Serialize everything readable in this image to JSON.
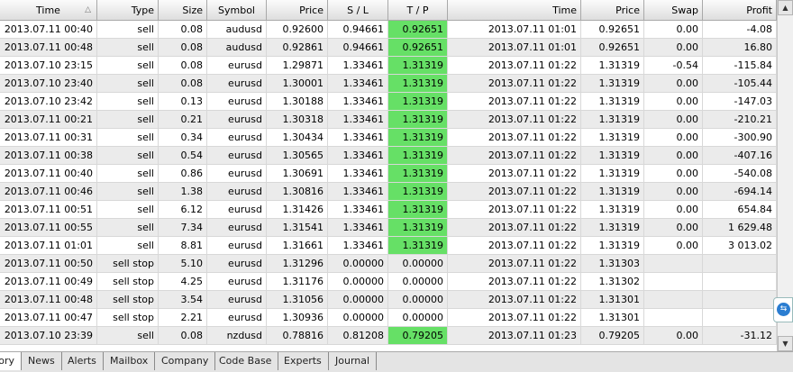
{
  "columns": [
    "Time",
    "Type",
    "Size",
    "Symbol",
    "Price",
    "S / L",
    "T / P",
    "Time",
    "Price",
    "Swap",
    "Profit"
  ],
  "rows": [
    {
      "time": "2013.07.11 00:40",
      "type": "sell",
      "size": "0.08",
      "symbol": "audusd",
      "price": "0.92600",
      "sl": "0.94661",
      "tp": "0.92651",
      "close_time": "2013.07.11 01:01",
      "close_price": "0.92651",
      "swap": "0.00",
      "profit": "-4.08",
      "tp_hit": true
    },
    {
      "time": "2013.07.11 00:48",
      "type": "sell",
      "size": "0.08",
      "symbol": "audusd",
      "price": "0.92861",
      "sl": "0.94661",
      "tp": "0.92651",
      "close_time": "2013.07.11 01:01",
      "close_price": "0.92651",
      "swap": "0.00",
      "profit": "16.80",
      "tp_hit": true
    },
    {
      "time": "2013.07.10 23:15",
      "type": "sell",
      "size": "0.08",
      "symbol": "eurusd",
      "price": "1.29871",
      "sl": "1.33461",
      "tp": "1.31319",
      "close_time": "2013.07.11 01:22",
      "close_price": "1.31319",
      "swap": "-0.54",
      "profit": "-115.84",
      "tp_hit": true
    },
    {
      "time": "2013.07.10 23:40",
      "type": "sell",
      "size": "0.08",
      "symbol": "eurusd",
      "price": "1.30001",
      "sl": "1.33461",
      "tp": "1.31319",
      "close_time": "2013.07.11 01:22",
      "close_price": "1.31319",
      "swap": "0.00",
      "profit": "-105.44",
      "tp_hit": true
    },
    {
      "time": "2013.07.10 23:42",
      "type": "sell",
      "size": "0.13",
      "symbol": "eurusd",
      "price": "1.30188",
      "sl": "1.33461",
      "tp": "1.31319",
      "close_time": "2013.07.11 01:22",
      "close_price": "1.31319",
      "swap": "0.00",
      "profit": "-147.03",
      "tp_hit": true
    },
    {
      "time": "2013.07.11 00:21",
      "type": "sell",
      "size": "0.21",
      "symbol": "eurusd",
      "price": "1.30318",
      "sl": "1.33461",
      "tp": "1.31319",
      "close_time": "2013.07.11 01:22",
      "close_price": "1.31319",
      "swap": "0.00",
      "profit": "-210.21",
      "tp_hit": true
    },
    {
      "time": "2013.07.11 00:31",
      "type": "sell",
      "size": "0.34",
      "symbol": "eurusd",
      "price": "1.30434",
      "sl": "1.33461",
      "tp": "1.31319",
      "close_time": "2013.07.11 01:22",
      "close_price": "1.31319",
      "swap": "0.00",
      "profit": "-300.90",
      "tp_hit": true
    },
    {
      "time": "2013.07.11 00:38",
      "type": "sell",
      "size": "0.54",
      "symbol": "eurusd",
      "price": "1.30565",
      "sl": "1.33461",
      "tp": "1.31319",
      "close_time": "2013.07.11 01:22",
      "close_price": "1.31319",
      "swap": "0.00",
      "profit": "-407.16",
      "tp_hit": true
    },
    {
      "time": "2013.07.11 00:40",
      "type": "sell",
      "size": "0.86",
      "symbol": "eurusd",
      "price": "1.30691",
      "sl": "1.33461",
      "tp": "1.31319",
      "close_time": "2013.07.11 01:22",
      "close_price": "1.31319",
      "swap": "0.00",
      "profit": "-540.08",
      "tp_hit": true
    },
    {
      "time": "2013.07.11 00:46",
      "type": "sell",
      "size": "1.38",
      "symbol": "eurusd",
      "price": "1.30816",
      "sl": "1.33461",
      "tp": "1.31319",
      "close_time": "2013.07.11 01:22",
      "close_price": "1.31319",
      "swap": "0.00",
      "profit": "-694.14",
      "tp_hit": true
    },
    {
      "time": "2013.07.11 00:51",
      "type": "sell",
      "size": "6.12",
      "symbol": "eurusd",
      "price": "1.31426",
      "sl": "1.33461",
      "tp": "1.31319",
      "close_time": "2013.07.11 01:22",
      "close_price": "1.31319",
      "swap": "0.00",
      "profit": "654.84",
      "tp_hit": true
    },
    {
      "time": "2013.07.11 00:55",
      "type": "sell",
      "size": "7.34",
      "symbol": "eurusd",
      "price": "1.31541",
      "sl": "1.33461",
      "tp": "1.31319",
      "close_time": "2013.07.11 01:22",
      "close_price": "1.31319",
      "swap": "0.00",
      "profit": "1 629.48",
      "tp_hit": true
    },
    {
      "time": "2013.07.11 01:01",
      "type": "sell",
      "size": "8.81",
      "symbol": "eurusd",
      "price": "1.31661",
      "sl": "1.33461",
      "tp": "1.31319",
      "close_time": "2013.07.11 01:22",
      "close_price": "1.31319",
      "swap": "0.00",
      "profit": "3 013.02",
      "tp_hit": true
    },
    {
      "time": "2013.07.11 00:50",
      "type": "sell stop",
      "size": "5.10",
      "symbol": "eurusd",
      "price": "1.31296",
      "sl": "0.00000",
      "tp": "0.00000",
      "close_time": "2013.07.11 01:22",
      "close_price": "1.31303",
      "swap": "",
      "profit": "",
      "tp_hit": false
    },
    {
      "time": "2013.07.11 00:49",
      "type": "sell stop",
      "size": "4.25",
      "symbol": "eurusd",
      "price": "1.31176",
      "sl": "0.00000",
      "tp": "0.00000",
      "close_time": "2013.07.11 01:22",
      "close_price": "1.31302",
      "swap": "",
      "profit": "",
      "tp_hit": false
    },
    {
      "time": "2013.07.11 00:48",
      "type": "sell stop",
      "size": "3.54",
      "symbol": "eurusd",
      "price": "1.31056",
      "sl": "0.00000",
      "tp": "0.00000",
      "close_time": "2013.07.11 01:22",
      "close_price": "1.31301",
      "swap": "",
      "profit": "",
      "tp_hit": false
    },
    {
      "time": "2013.07.11 00:47",
      "type": "sell stop",
      "size": "2.21",
      "symbol": "eurusd",
      "price": "1.30936",
      "sl": "0.00000",
      "tp": "0.00000",
      "close_time": "2013.07.11 01:22",
      "close_price": "1.31301",
      "swap": "",
      "profit": "",
      "tp_hit": false
    },
    {
      "time": "2013.07.10 23:39",
      "type": "sell",
      "size": "0.08",
      "symbol": "nzdusd",
      "price": "0.78816",
      "sl": "0.81208",
      "tp": "0.79205",
      "close_time": "2013.07.11 01:23",
      "close_price": "0.79205",
      "swap": "0.00",
      "profit": "-31.12",
      "tp_hit": true
    }
  ],
  "tabs": [
    "History",
    "News",
    "Alerts",
    "Mailbox",
    "Company",
    "Code Base",
    "Experts",
    "Journal"
  ],
  "active_tab": "History",
  "colors": {
    "tp_hit": "#66e066",
    "row_alt": "#ebebeb",
    "header": "#dedede"
  },
  "icons": {
    "sort": "sort-ascending-icon",
    "teamviewer": "teamviewer-icon"
  }
}
